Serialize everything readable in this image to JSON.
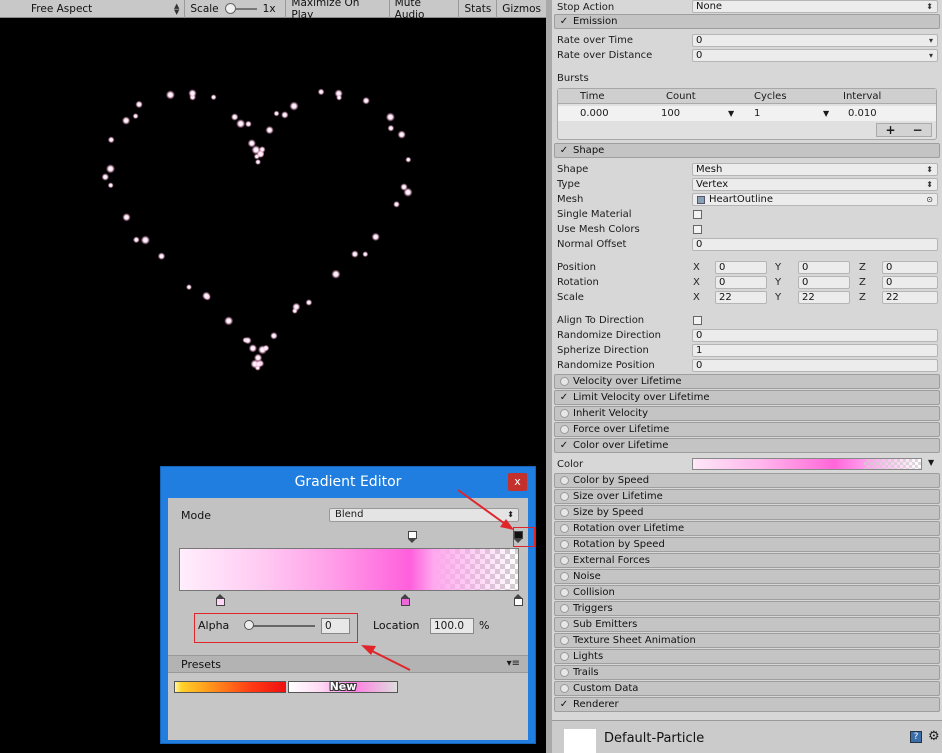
{
  "game_toolbar": {
    "aspect": "Free Aspect",
    "scale_label": "Scale",
    "scale_value": "1x",
    "maximize": "Maximize On Play",
    "mute": "Mute Audio",
    "stats": "Stats",
    "gizmos": "Gizmos"
  },
  "inspector": {
    "stop_action": {
      "label": "Stop Action",
      "value": "None"
    },
    "emission": {
      "title": "Emission",
      "rate_time": {
        "label": "Rate over Time",
        "value": "0"
      },
      "rate_distance": {
        "label": "Rate over Distance",
        "value": "0"
      },
      "bursts_label": "Bursts",
      "bursts_headers": [
        "Time",
        "Count",
        "Cycles",
        "Interval"
      ],
      "bursts_row": {
        "time": "0.000",
        "count": "100",
        "cycles": "1",
        "interval": "0.010"
      },
      "add": "+",
      "remove": "−"
    },
    "shape": {
      "title": "Shape",
      "shape": {
        "label": "Shape",
        "value": "Mesh"
      },
      "type": {
        "label": "Type",
        "value": "Vertex"
      },
      "mesh": {
        "label": "Mesh",
        "value": "HeartOutline"
      },
      "single_material": "Single Material",
      "use_mesh_colors": "Use Mesh Colors",
      "normal_offset": {
        "label": "Normal Offset",
        "value": "0"
      },
      "position": {
        "label": "Position",
        "x": "0",
        "y": "0",
        "z": "0"
      },
      "rotation": {
        "label": "Rotation",
        "x": "0",
        "y": "0",
        "z": "0"
      },
      "scale": {
        "label": "Scale",
        "x": "22",
        "y": "22",
        "z": "22"
      },
      "axis_x": "X",
      "axis_y": "Y",
      "axis_z": "Z",
      "align_direction": "Align To Direction",
      "randomize_direction": {
        "label": "Randomize Direction",
        "value": "0"
      },
      "spherize_direction": {
        "label": "Spherize Direction",
        "value": "1"
      },
      "randomize_position": {
        "label": "Randomize Position",
        "value": "0"
      }
    },
    "modules_a": [
      {
        "label": "Velocity over Lifetime",
        "enabled": false
      },
      {
        "label": "Limit Velocity over Lifetime",
        "enabled": true
      },
      {
        "label": "Inherit Velocity",
        "enabled": false
      },
      {
        "label": "Force over Lifetime",
        "enabled": false
      },
      {
        "label": "Color over Lifetime",
        "enabled": true
      }
    ],
    "color_label": "Color",
    "modules_b": [
      {
        "label": "Color by Speed",
        "enabled": false
      },
      {
        "label": "Size over Lifetime",
        "enabled": false
      },
      {
        "label": "Size by Speed",
        "enabled": false
      },
      {
        "label": "Rotation over Lifetime",
        "enabled": false
      },
      {
        "label": "Rotation by Speed",
        "enabled": false
      },
      {
        "label": "External Forces",
        "enabled": false
      },
      {
        "label": "Noise",
        "enabled": false
      },
      {
        "label": "Collision",
        "enabled": false
      },
      {
        "label": "Triggers",
        "enabled": false
      },
      {
        "label": "Sub Emitters",
        "enabled": false
      },
      {
        "label": "Texture Sheet Animation",
        "enabled": false
      },
      {
        "label": "Lights",
        "enabled": false
      },
      {
        "label": "Trails",
        "enabled": false
      },
      {
        "label": "Custom Data",
        "enabled": false
      },
      {
        "label": "Renderer",
        "enabled": true
      }
    ],
    "material_name": "Default-Particle"
  },
  "gradient_editor": {
    "title": "Gradient Editor",
    "close": "x",
    "mode_label": "Mode",
    "mode_value": "Blend",
    "alpha_label": "Alpha",
    "alpha_value": "0",
    "location_label": "Location",
    "location_value": "100.0",
    "percent": "%",
    "presets_label": "Presets",
    "new_label": "New"
  }
}
